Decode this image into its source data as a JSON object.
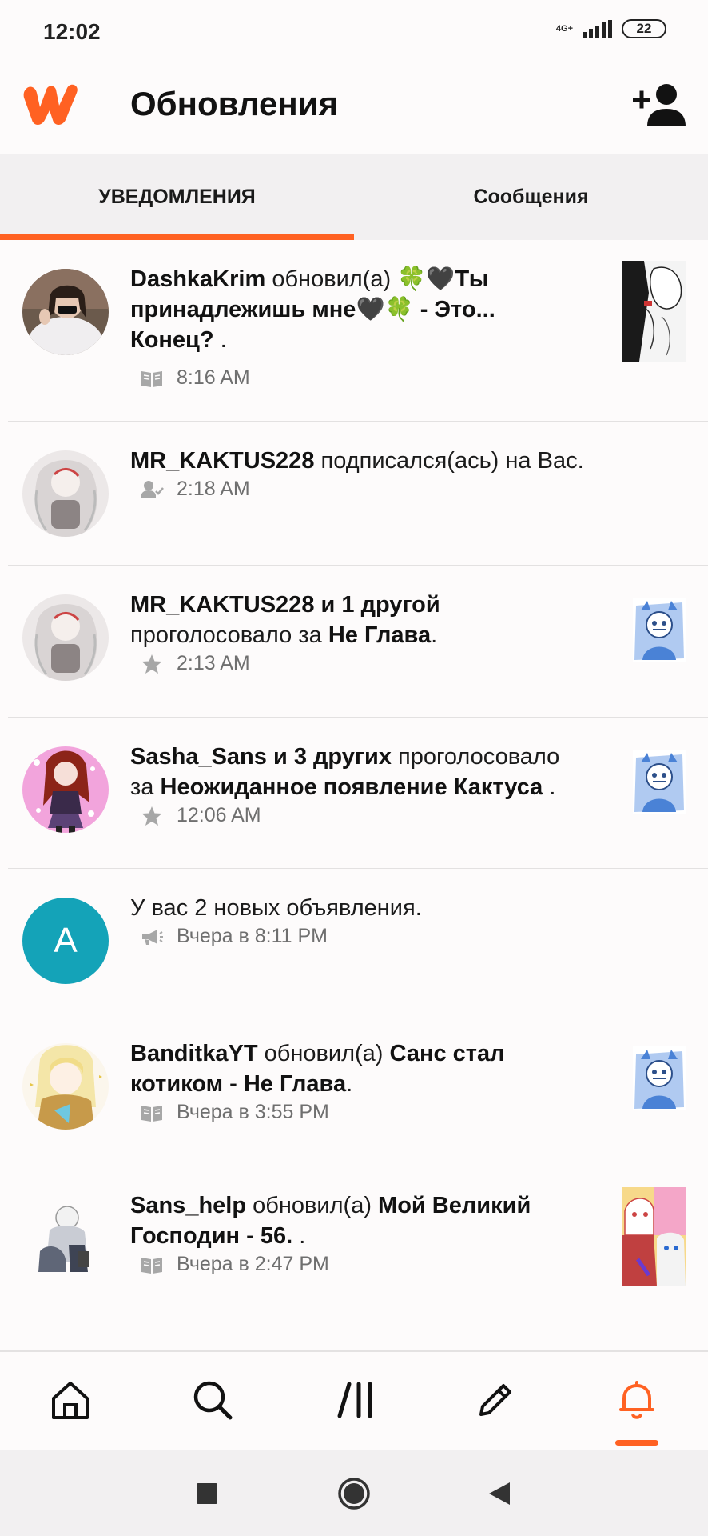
{
  "status_bar": {
    "time": "12:02",
    "network": "4G+",
    "battery": "22"
  },
  "header": {
    "title": "Обновления"
  },
  "tabs": [
    {
      "label": "УВЕДОМЛЕНИЯ",
      "active": true
    },
    {
      "label": "Сообщения",
      "active": false
    }
  ],
  "notifications": [
    {
      "user": "DashkaKrim",
      "action": "обновил(а)",
      "story_line1": "🍀🖤Ты",
      "story_line2": "принадлежишь мне🖤🍀 - Это...",
      "story_line3": "Конец?",
      "suffix": " .",
      "meta_icon": "book-icon",
      "time": "8:16 AM"
    },
    {
      "user": "MR_KAKTUS228",
      "action": "подписался(ась) на Вас.",
      "meta_icon": "user-follow-icon",
      "time": "2:18 AM"
    },
    {
      "user": "MR_KAKTUS228 и 1 другой",
      "action": "проголосовало за",
      "story": "Не Глава",
      "suffix": ".",
      "meta_icon": "star-icon",
      "time": "2:13 AM"
    },
    {
      "user": "Sasha_Sans и 3 других",
      "action": "проголосовало",
      "action2": "за",
      "story": "Неожиданное появление Кактуса",
      "suffix": " .",
      "meta_icon": "star-icon",
      "time": "12:06 AM"
    },
    {
      "avatar_letter": "A",
      "text": "У вас 2 новых объявления.",
      "meta_icon": "megaphone-icon",
      "time": "Вчера в 8:11 PM"
    },
    {
      "user": "BanditkaYT",
      "action": "обновил(а)",
      "story_line1": "Санс стал",
      "story_line2": "котиком - Не Глава",
      "suffix": ".",
      "meta_icon": "book-icon",
      "time": "Вчера в 3:55 PM"
    },
    {
      "user": "Sans_help",
      "action": "обновил(а)",
      "story_line1": "Мой Великий",
      "story_line2": "Господин - 56.",
      "suffix": " .",
      "meta_icon": "book-icon",
      "time": "Вчера в 2:47 PM"
    }
  ],
  "bottom_nav": [
    "home-icon",
    "search-icon",
    "library-icon",
    "write-icon",
    "bell-icon"
  ],
  "colors": {
    "accent": "#ff6122",
    "avatar_teal": "#14a3b8"
  }
}
